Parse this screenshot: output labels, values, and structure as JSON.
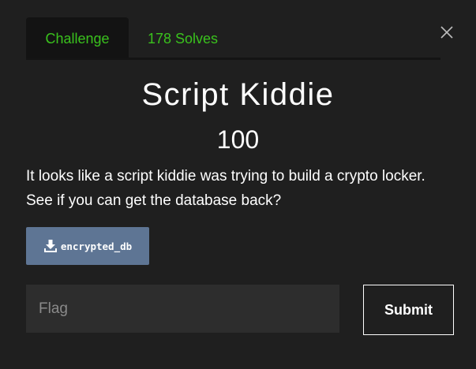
{
  "tabs": [
    {
      "label": "Challenge",
      "active": true
    },
    {
      "label": "178 Solves",
      "active": false
    }
  ],
  "challenge": {
    "title": "Script Kiddie",
    "points": "100",
    "description_lines": [
      "It looks like a script kiddie was trying to build a crypto locker.",
      "See if you can get the database back?"
    ]
  },
  "file": {
    "label": "encrypted_db",
    "icon": "download-icon"
  },
  "flag_input": {
    "placeholder": "Flag",
    "value": ""
  },
  "submit": {
    "label": "Submit"
  },
  "colors": {
    "background": "#1f1f1f",
    "tab_text": "#3ac21d",
    "active_tab_bg": "#131313",
    "file_button": "#5e7594",
    "input_bg": "#2d2d2d"
  },
  "icons": {
    "close": "close-icon",
    "download": "download-icon"
  }
}
